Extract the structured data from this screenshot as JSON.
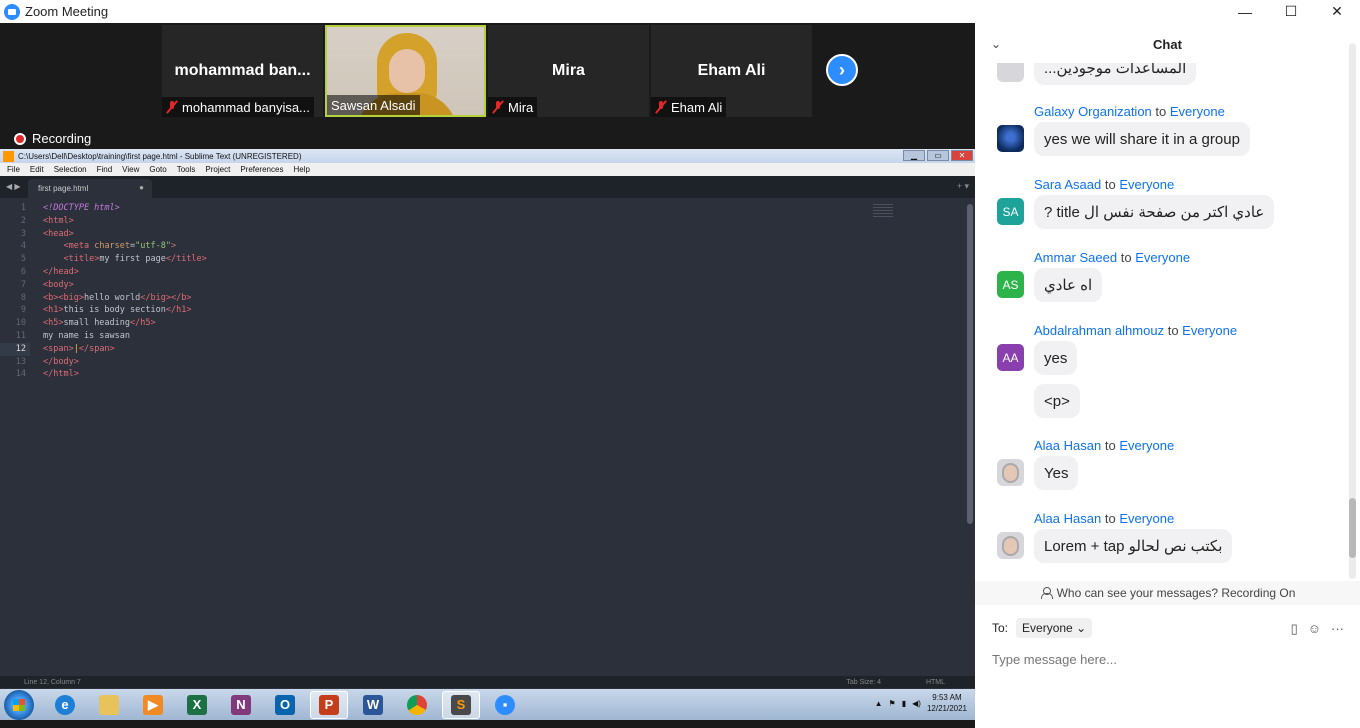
{
  "window": {
    "title": "Zoom Meeting",
    "minimize": "—",
    "maximize": "☐",
    "close": "✕"
  },
  "participants": [
    {
      "display": "mohammad  ban...",
      "label": "mohammad banyisa..."
    },
    {
      "label": "Sawsan Alsadi"
    },
    {
      "display": "Mira",
      "label": "Mira"
    },
    {
      "display": "Eham Ali",
      "label": "Eham Ali"
    }
  ],
  "recording": "Recording",
  "sublime": {
    "title": "C:\\Users\\Dell\\Desktop\\training\\first page.html - Sublime Text (UNREGISTERED)",
    "menu": [
      "File",
      "Edit",
      "Selection",
      "Find",
      "View",
      "Goto",
      "Tools",
      "Project",
      "Preferences",
      "Help"
    ],
    "tab": "first page.html",
    "line_numbers": [
      "1",
      "2",
      "3",
      "4",
      "5",
      "6",
      "7",
      "8",
      "9",
      "10",
      "11",
      "12",
      "13",
      "14"
    ],
    "status_left": "Line 12, Column 7",
    "tab_size": "Tab Size: 4",
    "syntax": "HTML"
  },
  "taskbar": {
    "apps": [
      "ie-icon",
      "folder-icon",
      "media-player-icon",
      "excel-icon",
      "onenote-icon",
      "outlook-icon",
      "powerpoint-icon",
      "word-icon",
      "chrome-icon",
      "sublime-icon",
      "zoom-icon"
    ],
    "time": "9:53 AM",
    "date": "12/21/2021"
  },
  "chat": {
    "title": "Chat",
    "partial_top": "...المساعدات موجودين",
    "messages": [
      {
        "sender": "Galaxy Organization",
        "to": "to",
        "recipient": "Everyone",
        "text": "yes we will share it in a group"
      },
      {
        "sender": "Sara Asaad",
        "to": "to",
        "recipient": "Everyone",
        "initials": "SA",
        "text": "عادي اكتر من صفحة نفس ال title ?"
      },
      {
        "sender": "Ammar Saeed",
        "to": "to",
        "recipient": "Everyone",
        "initials": "AS",
        "text": "اه عادي"
      },
      {
        "sender": "Abdalrahman alhmouz",
        "to": "to",
        "recipient": "Everyone",
        "initials": "AA",
        "text": "yes",
        "text2": "<p>"
      },
      {
        "sender": "Alaa Hasan",
        "to": "to",
        "recipient": "Everyone",
        "text": "Yes"
      },
      {
        "sender": "Alaa Hasan",
        "to": "to",
        "recipient": "Everyone",
        "text": "بكتب نص لحالو Lorem + tap"
      }
    ],
    "visibility_note": "Who can see your messages? Recording On",
    "to_label": "To:",
    "to_value": "Everyone",
    "placeholder": "Type message here..."
  },
  "colors": {
    "zoom_blue": "#2d8cff",
    "link_blue": "#0e72ed",
    "editor_bg": "#2b303b",
    "avatar_sa": "#1ea39a",
    "avatar_as": "#2cb34a",
    "avatar_aa": "#8a3fae"
  }
}
